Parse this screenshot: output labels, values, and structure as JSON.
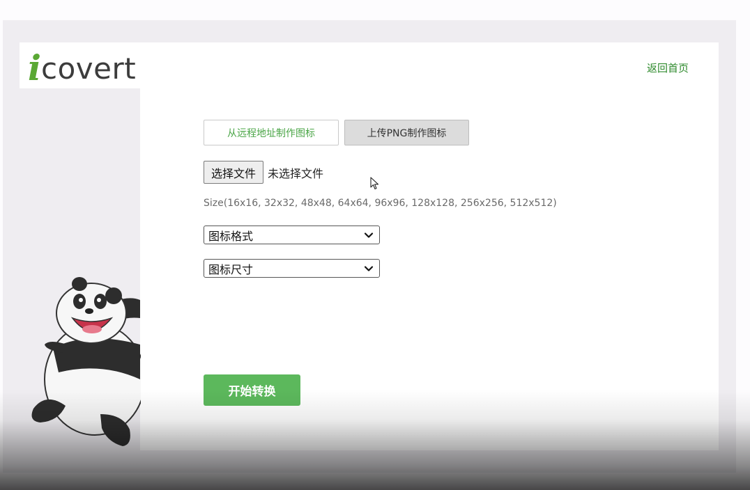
{
  "logo": {
    "i": "i",
    "text": "covert"
  },
  "header": {
    "home_link": "返回首页"
  },
  "tabs": [
    {
      "label": "从远程地址制作图标",
      "active": false
    },
    {
      "label": "上传PNG制作图标",
      "active": true
    }
  ],
  "file_input": {
    "button_label": "选择文件",
    "status": "未选择文件"
  },
  "size_hint": "Size(16x16, 32x32, 48x48, 64x64, 96x96, 128x128, 256x256, 512x512)",
  "selects": {
    "format": {
      "selected": "图标格式"
    },
    "size": {
      "selected": "图标尺寸"
    }
  },
  "convert_button": {
    "label": "开始转换"
  },
  "colors": {
    "accent_green": "#5cb85c",
    "link_green": "#2e8a2c",
    "logo_green": "#5aa834"
  },
  "icons": [
    "chevron-down-icon",
    "mouse-cursor-icon",
    "panda-mascot"
  ]
}
